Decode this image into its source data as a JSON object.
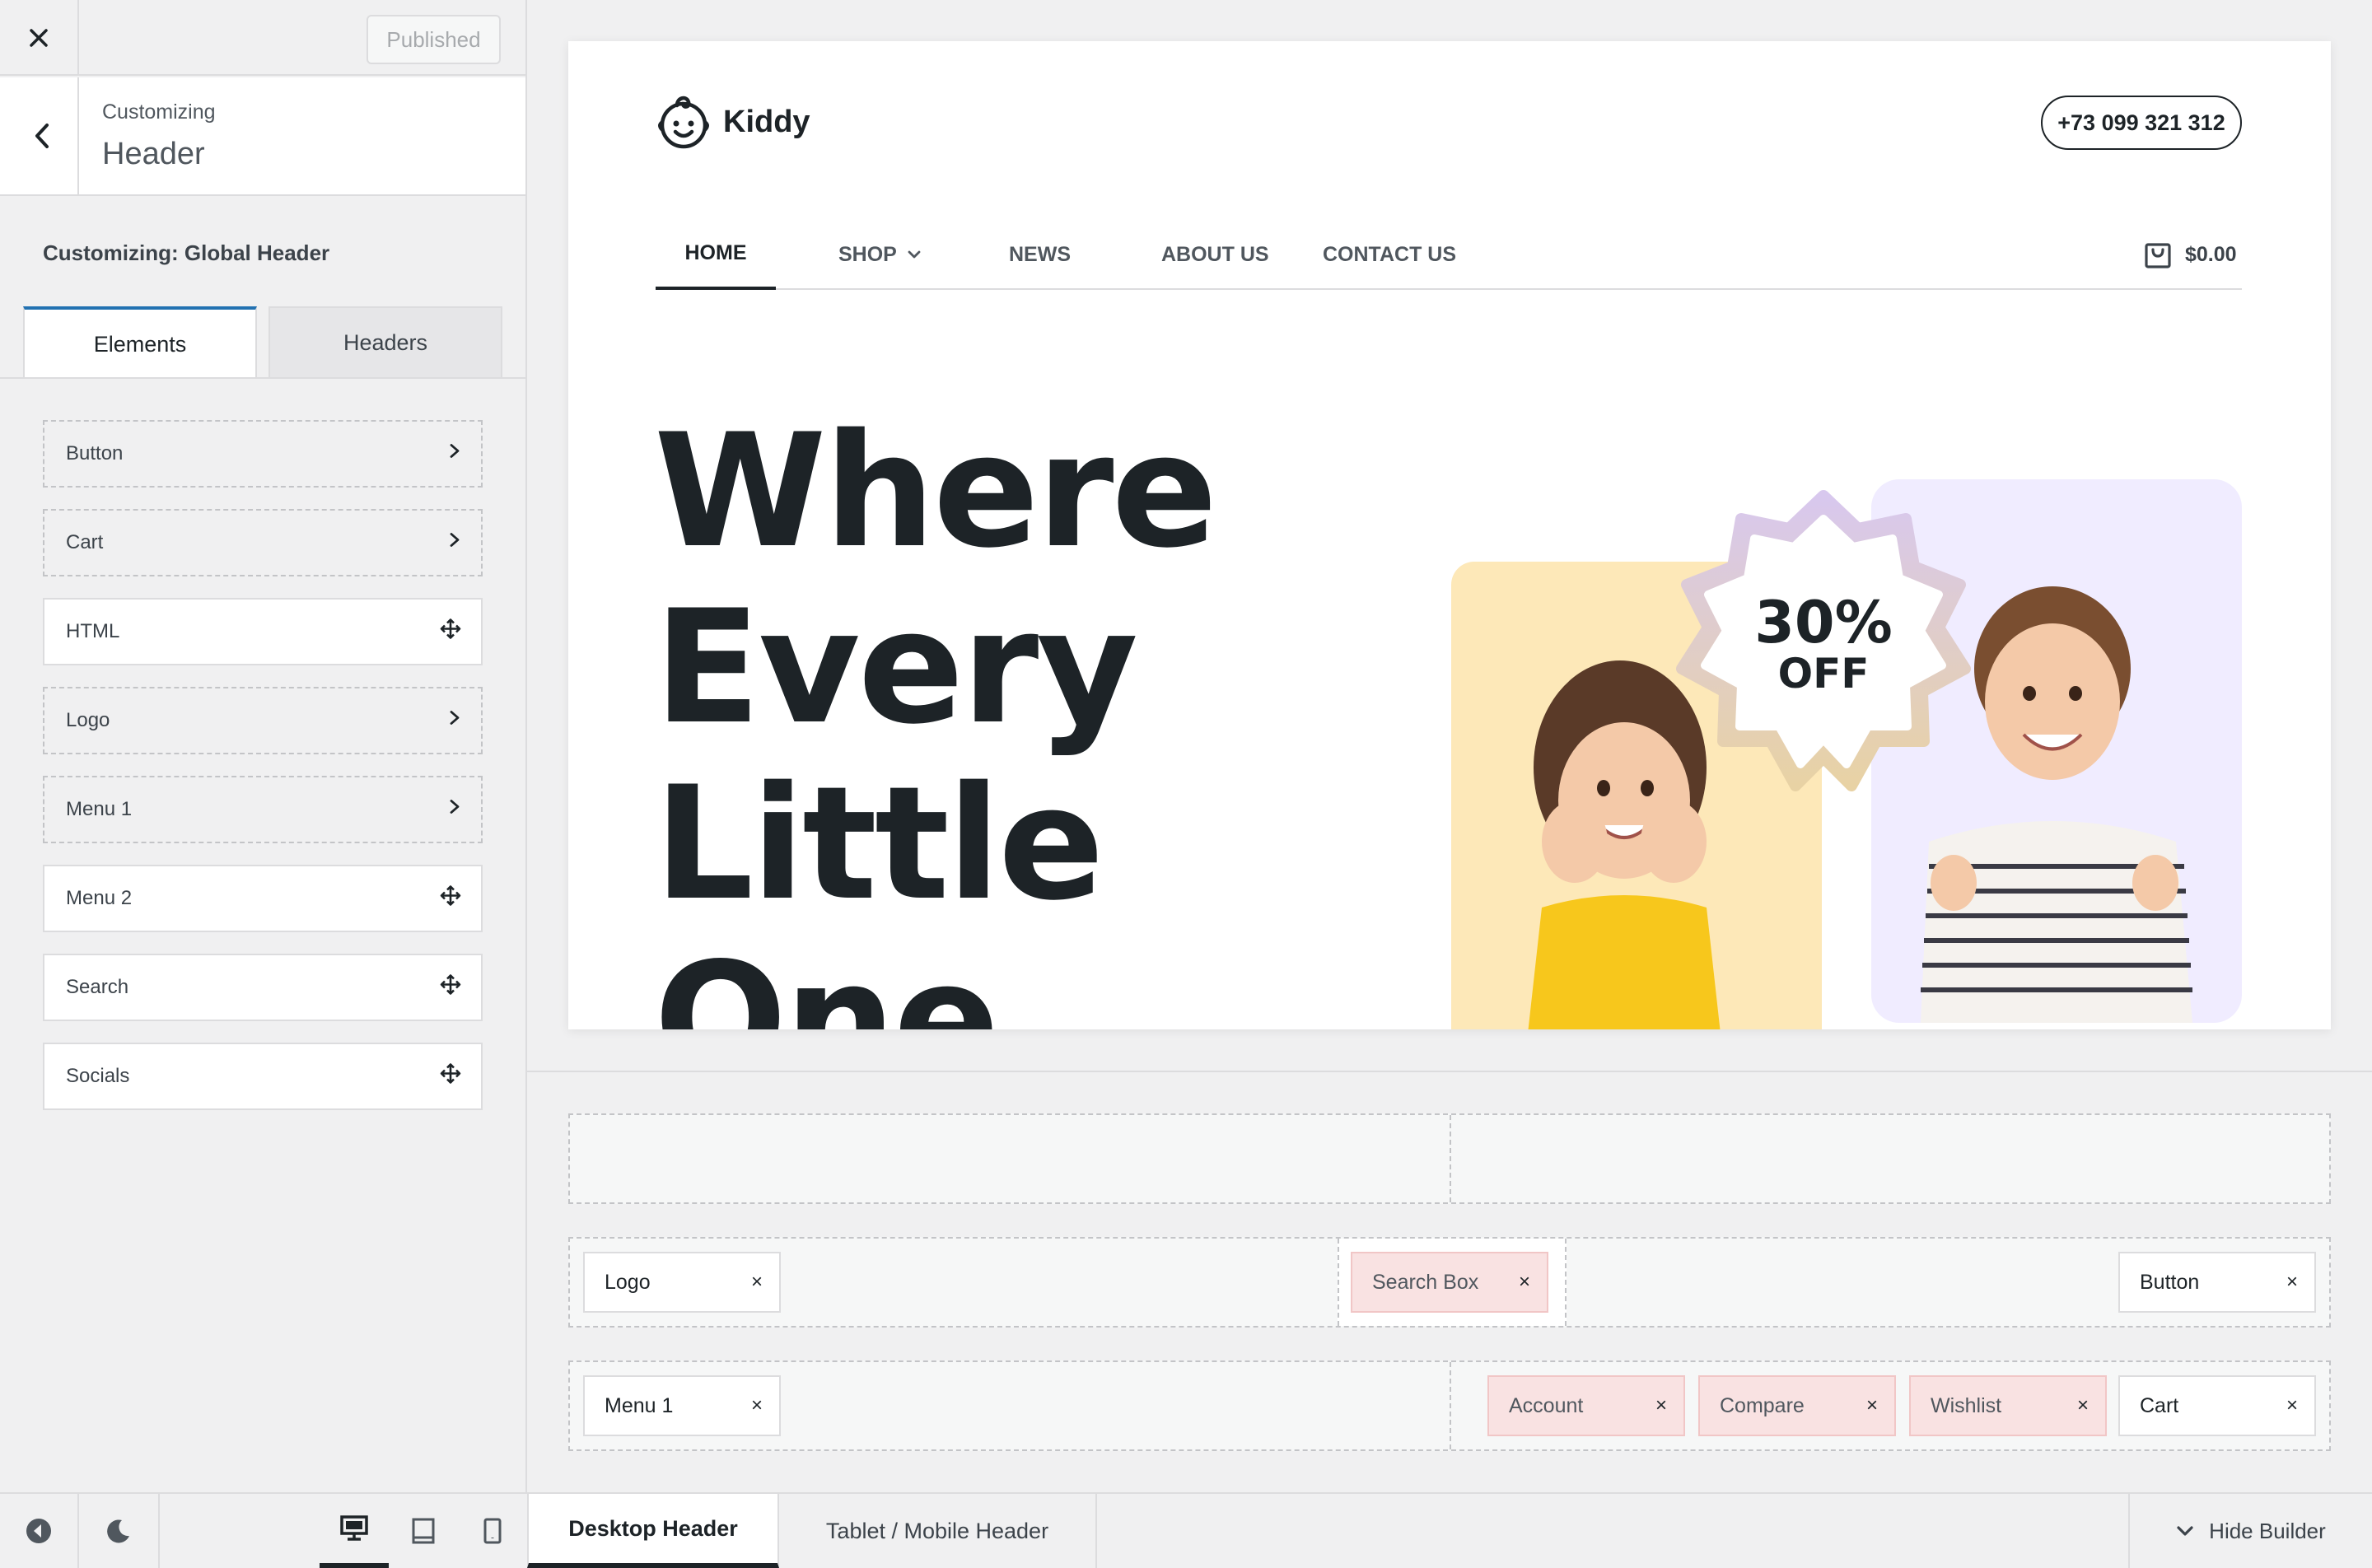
{
  "sidebar": {
    "published_label": "Published",
    "head_sub": "Customizing",
    "head_title": "Header",
    "global_title": "Customizing: Global Header",
    "tabs": [
      {
        "label": "Elements",
        "active": true
      },
      {
        "label": "Headers",
        "active": false
      }
    ],
    "elements": [
      {
        "label": "Button",
        "style": "dashed",
        "icon": "chevron-right-icon"
      },
      {
        "label": "Cart",
        "style": "dashed",
        "icon": "chevron-right-icon"
      },
      {
        "label": "HTML",
        "style": "solid",
        "icon": "move-icon"
      },
      {
        "label": "Logo",
        "style": "dashed",
        "icon": "chevron-right-icon"
      },
      {
        "label": "Menu 1",
        "style": "dashed",
        "icon": "chevron-right-icon"
      },
      {
        "label": "Menu 2",
        "style": "solid",
        "icon": "move-icon"
      },
      {
        "label": "Search",
        "style": "solid",
        "icon": "move-icon"
      },
      {
        "label": "Socials",
        "style": "solid",
        "icon": "move-icon"
      }
    ]
  },
  "bottombar": {
    "tabs": [
      {
        "label": "Desktop Header",
        "active": true
      },
      {
        "label": "Tablet / Mobile Header",
        "active": false
      }
    ],
    "hide_builder_label": "Hide Builder",
    "devices": [
      "desktop-icon",
      "tablet-icon",
      "mobile-icon"
    ],
    "active_device": "desktop"
  },
  "preview": {
    "logo_text": "Kiddy",
    "phone": "+73 099 321 312",
    "nav": [
      {
        "label": "HOME",
        "active": true
      },
      {
        "label": "SHOP",
        "dropdown": true
      },
      {
        "label": "NEWS"
      },
      {
        "label": "ABOUT US"
      },
      {
        "label": "CONTACT US"
      }
    ],
    "cart_total": "$0.00",
    "hero_lines": [
      "Where",
      "Every",
      "Little",
      "One"
    ],
    "badge_percent": "30%",
    "badge_off": "OFF"
  },
  "builder": {
    "rows": [
      {
        "left": [],
        "right": []
      },
      {
        "left": [
          {
            "label": "Logo"
          }
        ],
        "center": [
          {
            "label": "Search Box",
            "highlight": true
          }
        ],
        "right": [
          {
            "label": "Button"
          }
        ]
      },
      {
        "left": [
          {
            "label": "Menu 1"
          }
        ],
        "right": [
          {
            "label": "Account",
            "highlight": true
          },
          {
            "label": "Compare",
            "highlight": true
          },
          {
            "label": "Wishlist",
            "highlight": true
          },
          {
            "label": "Cart"
          }
        ]
      }
    ],
    "remove_glyph": "×"
  },
  "colors": {
    "accent": "#2271b1",
    "text_dark": "#1d2327",
    "chip_highlight": "#f9e2e2",
    "hero_yellow": "#fde8b8",
    "hero_purple": "#f0ecff"
  }
}
